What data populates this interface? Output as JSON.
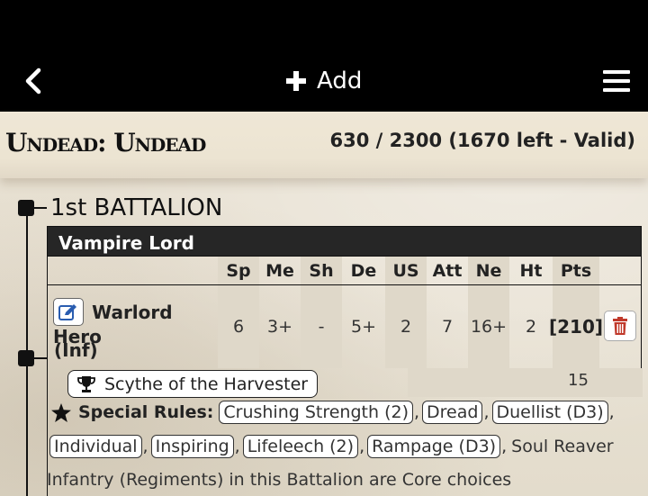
{
  "topbar": {
    "back_icon": "chevron-left-icon",
    "add_label": "Add",
    "add_icon": "plus-icon",
    "menu_icon": "hamburger-menu-icon"
  },
  "army": {
    "title": "Undead: Undead",
    "points_summary": "630 / 2300 (1670 left - Valid)"
  },
  "battalion": {
    "title": "1st BATTALION"
  },
  "unit": {
    "header": "Vampire Lord",
    "stat_headers": [
      "Sp",
      "Me",
      "Sh",
      "De",
      "US",
      "Att",
      "Ne",
      "Ht",
      "Pts"
    ],
    "name": "Warlord Hero",
    "type": "(Inf)",
    "stats": [
      "6",
      "3+",
      "-",
      "5+",
      "2",
      "7",
      "16+",
      "2",
      "[210]"
    ],
    "item": {
      "label": "Scythe of the Harvester",
      "icon": "trophy-icon",
      "points": "15"
    },
    "special_rules_label": "Special Rules:",
    "special_rules_icon": "star-icon",
    "rules": [
      "Crushing Strength (2)",
      "Dread",
      "Duellist (D3)",
      "Individual",
      "Inspiring",
      "Lifeleech (2)",
      "Rampage (D3)"
    ],
    "rule_soul_reaver": "Soul Reaver",
    "edit_icon": "edit-icon",
    "delete_icon": "trash-icon"
  },
  "note": "Infantry (Regiments) in this Battalion are Core choices",
  "colors": {
    "topbar": "#000000",
    "parchment": "#e7e0d1",
    "unit_header": "#262626",
    "delete": "#c0392b"
  }
}
